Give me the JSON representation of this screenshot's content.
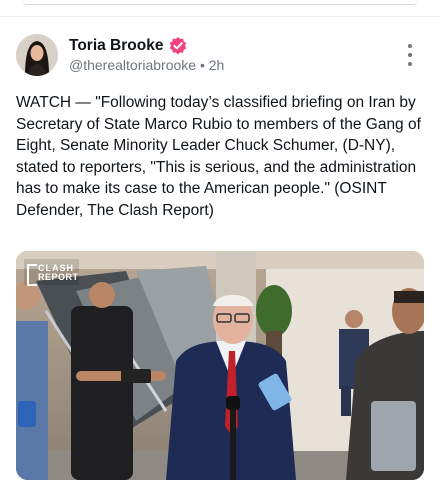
{
  "post": {
    "author_name": "Toria Brooke",
    "handle": "@therealtoriabrooke",
    "separator": "•",
    "time": "2h",
    "text": "WATCH — \"Following today’s classified briefing on Iran by Secretary of State Marco Rubio to members of the Gang of Eight, Senate Minority Leader Chuck Schumer, (D-NY), stated to reporters, \"This is serious, and the administration has to make its case to the American people.\" (OSINT Defender, The Clash Report)"
  },
  "media": {
    "watermark_line1": "CLASH",
    "watermark_line2": "REPORT"
  },
  "icons": {
    "verified": "verified-badge-icon",
    "more": "more-vertical-icon"
  },
  "colors": {
    "verified_badge": "#f3427c",
    "secondary_text": "#6e767d",
    "primary_text": "#0f1419"
  }
}
